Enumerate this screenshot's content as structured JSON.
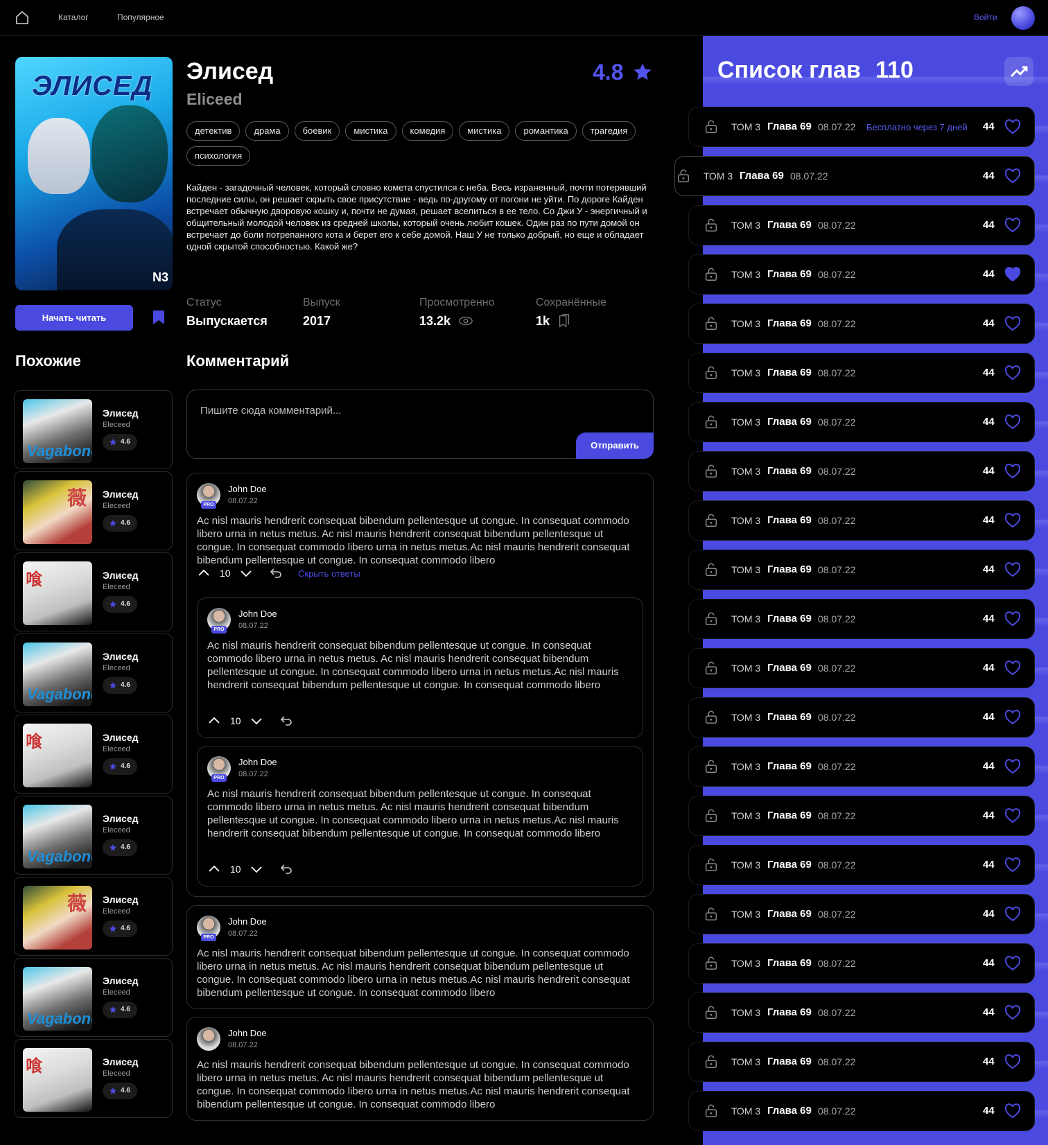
{
  "nav": {
    "catalog": "Каталог",
    "popular": "Популярное",
    "login": "Войти"
  },
  "manga": {
    "cover_title": "ЭЛИСЕД",
    "cover_logo": "N3",
    "title": "Элисед",
    "subtitle": "Eliceed",
    "rating": "4.8",
    "tags": [
      "детектив",
      "драма",
      "боевик",
      "мистика",
      "комедия",
      "мистика",
      "романтика",
      "трагедия",
      "психология"
    ],
    "description": "Кайден - загадочный человек, который словно комета спустился с неба. Весь израненный, почти потерявший последние силы, он решает скрыть свое присутствие - ведь по-другому от погони не уйти. По дороге Кайден встречает обычную дворовую кошку и, почти не думая, решает вселиться в ее тело. Со Джи У - энергичный и общительный молодой человек из средней школы, который очень любит кошек. Один раз по пути домой он встречает до боли потрепанного кота и берет его к себе домой. Наш У не только добрый, но еще и обладает одной скрытой способностью. Какой же?",
    "read_button": "Начать читать",
    "stats": {
      "status_label": "Статус",
      "status_value": "Выпускается",
      "year_label": "Выпуск",
      "year_value": "2017",
      "views_label": "Просмотренно",
      "views_value": "13.2k",
      "saved_label": "Сохранённые",
      "saved_value": "1k"
    }
  },
  "similar": {
    "heading": "Похожие",
    "items": [
      {
        "title": "Элисед",
        "sub": "Eleceed",
        "rating": "4.6",
        "cover": "vagabond"
      },
      {
        "title": "Элисед",
        "sub": "Eleceed",
        "rating": "4.6",
        "cover": "yellow"
      },
      {
        "title": "Элисед",
        "sub": "Eleceed",
        "rating": "4.6",
        "cover": "white"
      },
      {
        "title": "Элисед",
        "sub": "Eleceed",
        "rating": "4.6",
        "cover": "vagabond"
      },
      {
        "title": "Элисед",
        "sub": "Eleceed",
        "rating": "4.6",
        "cover": "white"
      },
      {
        "title": "Элисед",
        "sub": "Eleceed",
        "rating": "4.6",
        "cover": "vagabond"
      },
      {
        "title": "Элисед",
        "sub": "Eleceed",
        "rating": "4.6",
        "cover": "yellow"
      },
      {
        "title": "Элисед",
        "sub": "Eleceed",
        "rating": "4.6",
        "cover": "vagabond"
      },
      {
        "title": "Элисед",
        "sub": "Eleceed",
        "rating": "4.6",
        "cover": "white"
      }
    ],
    "cover_text": {
      "vagabond": "Vagabond",
      "yellow": "薇",
      "white": "喰"
    }
  },
  "comments": {
    "heading": "Комментарий",
    "placeholder": "Пишите сюда комментарий...",
    "send": "Отправить",
    "hide_replies": "Скрыть ответы",
    "pro": "PRO",
    "author": "John Doe",
    "date": "08.07.22",
    "votes": "10",
    "text": "Ac nisl mauris hendrerit consequat bibendum pellentesque ut congue. In consequat commodo libero urna in netus metus. Ac nisl mauris hendrerit consequat bibendum pellentesque ut congue. In consequat commodo libero urna in netus metus.Ac nisl mauris hendrerit consequat bibendum pellentesque ut congue. In consequat commodo libero"
  },
  "chapters": {
    "heading": "Список глав",
    "count": "110",
    "tom": "ТОМ 3",
    "chapter": "Глава 69",
    "date": "08.07.22",
    "likes": "44",
    "free_note": "Бесплатно через 7 дней",
    "liked_index": 3
  },
  "colors": {
    "accent": "#4a4ae0"
  }
}
